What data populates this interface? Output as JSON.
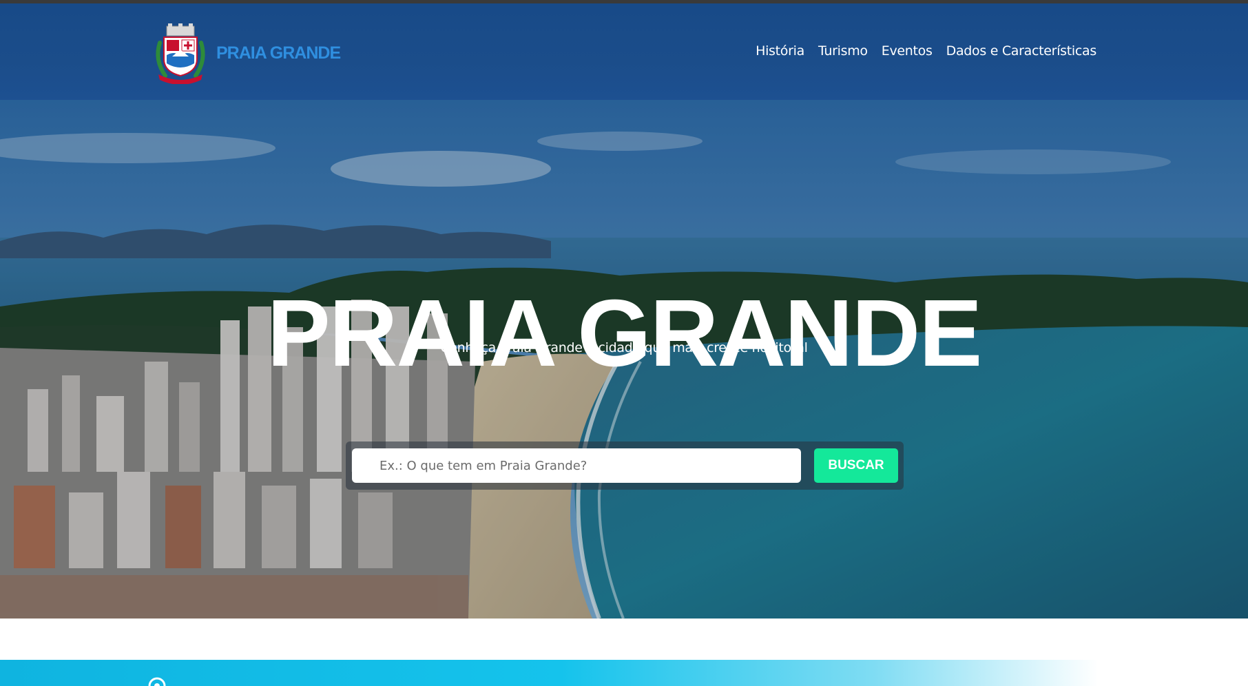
{
  "colors": {
    "navbar": "#1b4d8a",
    "brand_text": "#2f8fe0",
    "search_button": "#14e89a",
    "band": "#15c3ec"
  },
  "header": {
    "brand_name": "PRAIA GRANDE",
    "logo_icon": "coat-of-arms-icon",
    "nav_items": [
      {
        "label": "História"
      },
      {
        "label": "Turismo"
      },
      {
        "label": "Eventos"
      },
      {
        "label": "Dados e Características"
      }
    ]
  },
  "hero": {
    "title": "PRAIA GRANDE",
    "subtitle": "Conheça Praia Grande a cidade que mais cresce no litoral",
    "search": {
      "placeholder": "Ex.: O que tem em Praia Grande?",
      "value": "",
      "button_label": "BUSCAR"
    }
  },
  "section": {
    "icon": "location-pin-icon",
    "heading": ""
  }
}
